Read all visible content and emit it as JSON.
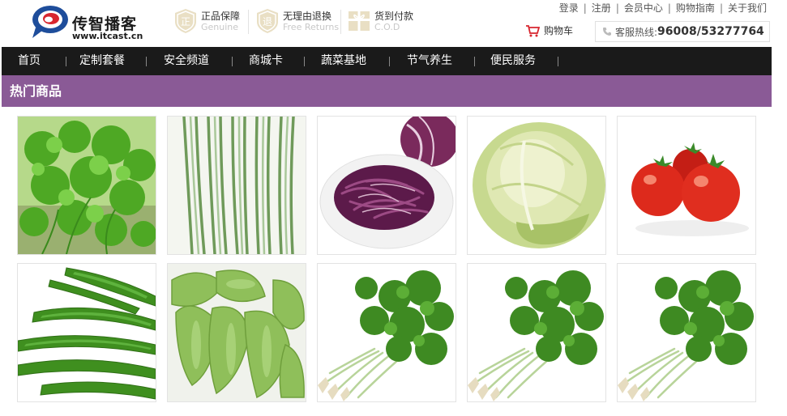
{
  "header": {
    "logo": {
      "name": "传智播客",
      "url": "www.itcast.cn"
    },
    "promises": [
      {
        "icon": "genuine-badge-icon",
        "title": "正品保障",
        "subtitle": "Genuine"
      },
      {
        "icon": "free-returns-badge-icon",
        "title": "无理由退换",
        "subtitle": "Free Returns"
      },
      {
        "icon": "cod-gift-icon",
        "title": "货到付款",
        "subtitle": "C.O.D"
      }
    ],
    "top_links": [
      "登录",
      "注册",
      "会员中心",
      "购物指南",
      "关于我们"
    ],
    "cart_label": "购物车",
    "hotline_label": "客服热线:",
    "hotline_number": "96008/53277764"
  },
  "nav": {
    "items": [
      "首页",
      "定制套餐",
      "安全频道",
      "商城卡",
      "蔬菜基地",
      "节气养生",
      "便民服务"
    ]
  },
  "section": {
    "title": "热门商品"
  },
  "products": [
    {
      "image": "parsley"
    },
    {
      "image": "chives"
    },
    {
      "image": "red-cabbage"
    },
    {
      "image": "lettuce"
    },
    {
      "image": "tomatoes"
    },
    {
      "image": "green-chilies"
    },
    {
      "image": "snow-peas"
    },
    {
      "image": "coriander"
    },
    {
      "image": "coriander"
    },
    {
      "image": "coriander"
    }
  ],
  "colors": {
    "nav_bg": "#1a1a1a",
    "section_bg": "#8a5a96",
    "brand_blue": "#1e4d9b",
    "brand_red": "#d8262e"
  }
}
